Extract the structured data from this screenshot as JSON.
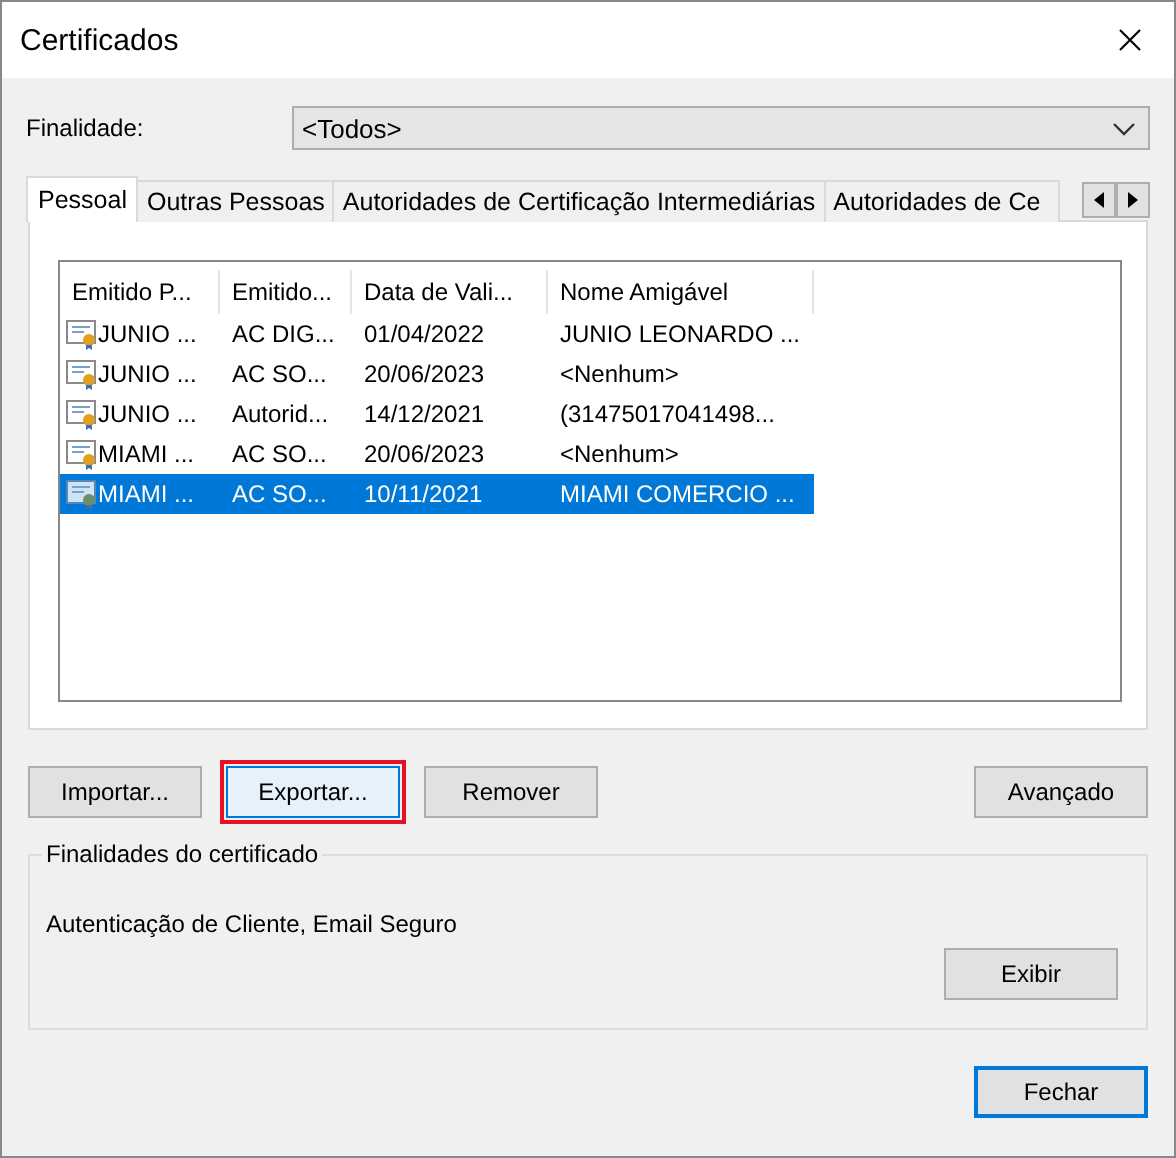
{
  "window": {
    "title": "Certificados"
  },
  "purpose": {
    "label": "Finalidade:",
    "value": "<Todos>"
  },
  "tabs": [
    {
      "label": "Pessoal",
      "selected": true
    },
    {
      "label": "Outras Pessoas",
      "selected": false
    },
    {
      "label": "Autoridades de Certificação Intermediárias",
      "selected": false
    },
    {
      "label": "Autoridades de Ce",
      "selected": false
    }
  ],
  "table": {
    "columns": [
      "Emitido P...",
      "Emitido...",
      "Data de Vali...",
      "Nome Amigável"
    ],
    "rows": [
      {
        "cells": [
          "JUNIO ...",
          "AC DIG...",
          "01/04/2022",
          "JUNIO LEONARDO ..."
        ],
        "selected": false
      },
      {
        "cells": [
          "JUNIO ...",
          "AC SO...",
          "20/06/2023",
          "<Nenhum>"
        ],
        "selected": false
      },
      {
        "cells": [
          "JUNIO ...",
          "Autorid...",
          "14/12/2021",
          "(31475017041498..."
        ],
        "selected": false
      },
      {
        "cells": [
          "MIAMI ...",
          "AC SO...",
          "20/06/2023",
          "<Nenhum>"
        ],
        "selected": false
      },
      {
        "cells": [
          "MIAMI ...",
          "AC SO...",
          "10/11/2021",
          "MIAMI COMERCIO ..."
        ],
        "selected": true
      }
    ]
  },
  "actions": [
    {
      "label": "Importar...",
      "highlighted": false
    },
    {
      "label": "Exportar...",
      "highlighted": true
    },
    {
      "label": "Remover",
      "highlighted": false
    },
    {
      "label": "Avançado",
      "highlighted": false
    }
  ],
  "purposes_group": {
    "title": "Finalidades do certificado",
    "text": "Autenticação de Cliente, Email Seguro",
    "button": "Exibir"
  },
  "close_button": {
    "label": "Fechar",
    "default": true
  }
}
